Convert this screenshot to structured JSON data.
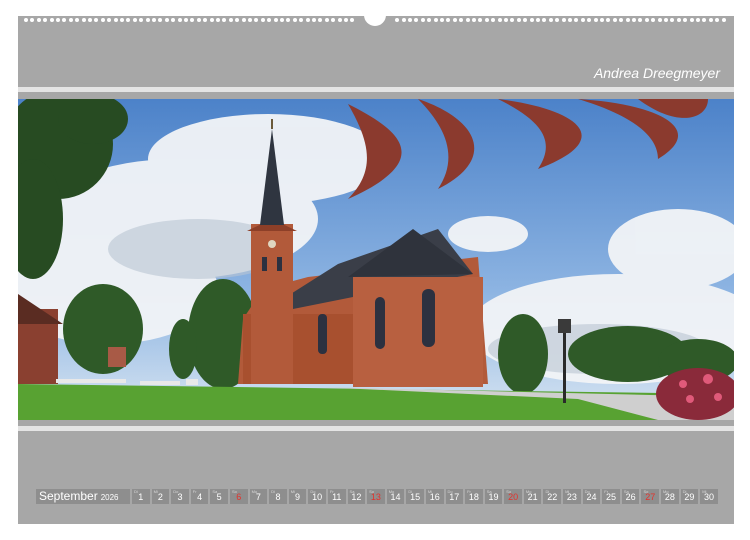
{
  "calendar": {
    "author": "Andrea Dreegmeyer",
    "month": "September",
    "year": "2026",
    "days": [
      {
        "n": "1",
        "wd": "Di"
      },
      {
        "n": "2",
        "wd": "Mi"
      },
      {
        "n": "3",
        "wd": "Do"
      },
      {
        "n": "4",
        "wd": "Fr"
      },
      {
        "n": "5",
        "wd": "Sa"
      },
      {
        "n": "6",
        "wd": "So",
        "sunday": true
      },
      {
        "n": "7",
        "wd": "Mo"
      },
      {
        "n": "8",
        "wd": "Di"
      },
      {
        "n": "9",
        "wd": "Mi"
      },
      {
        "n": "10",
        "wd": "Do"
      },
      {
        "n": "11",
        "wd": "Fr"
      },
      {
        "n": "12",
        "wd": "Sa"
      },
      {
        "n": "13",
        "wd": "So",
        "sunday": true
      },
      {
        "n": "14",
        "wd": "Mo"
      },
      {
        "n": "15",
        "wd": "Di"
      },
      {
        "n": "16",
        "wd": "Mi"
      },
      {
        "n": "17",
        "wd": "Do"
      },
      {
        "n": "18",
        "wd": "Fr"
      },
      {
        "n": "19",
        "wd": "Sa"
      },
      {
        "n": "20",
        "wd": "So",
        "sunday": true
      },
      {
        "n": "21",
        "wd": "Mo"
      },
      {
        "n": "22",
        "wd": "Di"
      },
      {
        "n": "23",
        "wd": "Mi"
      },
      {
        "n": "24",
        "wd": "Do"
      },
      {
        "n": "25",
        "wd": "Fr"
      },
      {
        "n": "26",
        "wd": "Sa"
      },
      {
        "n": "27",
        "wd": "So",
        "sunday": true
      },
      {
        "n": "28",
        "wd": "Mo"
      },
      {
        "n": "29",
        "wd": "Di"
      },
      {
        "n": "30",
        "wd": "Mi"
      }
    ]
  },
  "colors": {
    "sheet": "#a7a7a7",
    "cell": "#8e8e8e",
    "sunday": "#e3322c",
    "brick": "#b25a3a",
    "roof": "#3a3e48",
    "sky": "#5d8fd0",
    "grass": "#58a232"
  }
}
